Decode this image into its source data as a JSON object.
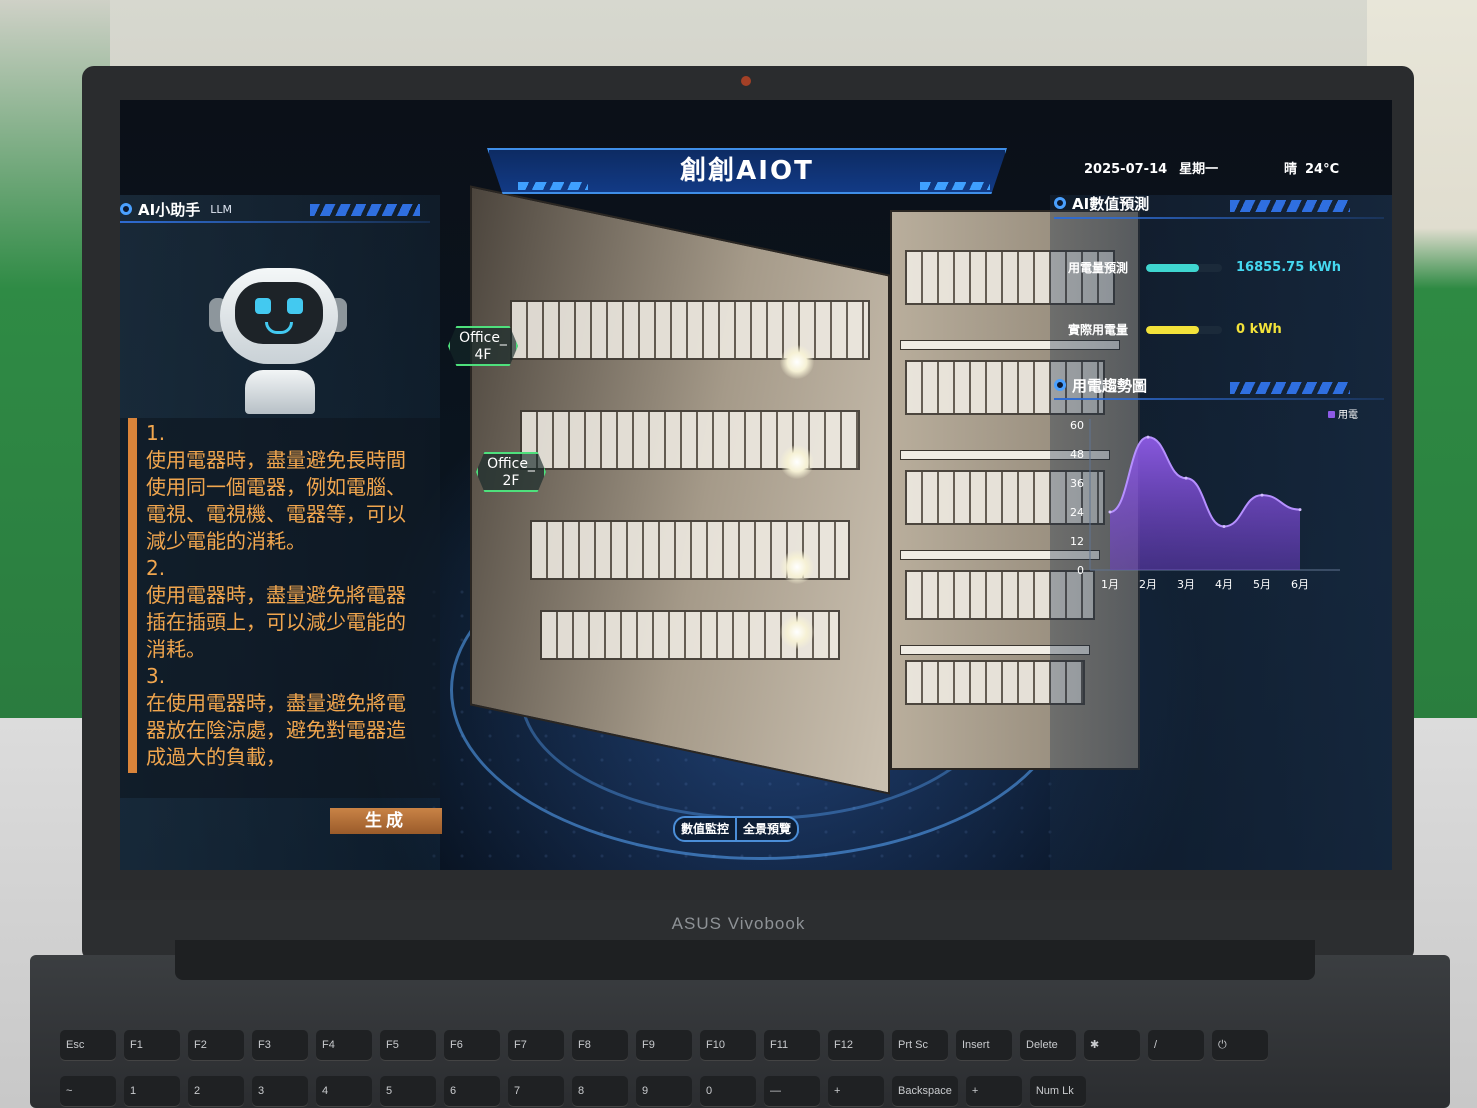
{
  "device": {
    "brand": "ASUS Vivobook"
  },
  "app": {
    "title": "創創AIOT",
    "date": "2025-07-14",
    "weekday": "星期一",
    "weather": "晴",
    "temperature": "24°C"
  },
  "left": {
    "section_title": "AI小助手",
    "section_tag": "LLM",
    "chat_text": "1.\n使用電器時，盡量避免長時間使用同一個電器，例如電腦、電視、電視機、電器等，可以減少電能的消耗。\n2.\n使用電器時，盡量避免將電器插在插頭上，可以減少電能的消耗。\n3.\n在使用電器時，盡量避免將電器放在陰涼處，避免對電器造成過大的負載，",
    "generate_button": "生成"
  },
  "scene": {
    "tags": [
      {
        "line1": "Office_",
        "line2": "4F"
      },
      {
        "line1": "Office_",
        "line2": "2F"
      }
    ],
    "tabs": [
      "數值監控",
      "全景預覽"
    ]
  },
  "right": {
    "prediction_title": "AI數值預測",
    "metrics": [
      {
        "label": "用電量預測",
        "value": "16855.75 kWh",
        "color": "#3fd6d0",
        "level": 0.7
      },
      {
        "label": "實際用電量",
        "value": "0 kWh",
        "color": "#f2e23a",
        "level": 0.7
      }
    ],
    "trend_title": "用電趨勢圖"
  },
  "chart_data": {
    "type": "area",
    "categories": [
      "1月",
      "2月",
      "3月",
      "4月",
      "5月",
      "6月"
    ],
    "series": [
      {
        "name": "用電",
        "values": [
          24,
          55,
          38,
          18,
          31,
          25
        ],
        "color": "#8e5be6"
      }
    ],
    "yticks": [
      0,
      12,
      24,
      36,
      48,
      60
    ],
    "ylim": [
      0,
      60
    ],
    "legend": "top-right"
  },
  "keyboard": {
    "row1": [
      "Esc",
      "F1",
      "F2",
      "F3",
      "F4",
      "F5",
      "F6",
      "F7",
      "F8",
      "F9",
      "F10",
      "F11",
      "F12",
      "Prt Sc",
      "Insert",
      "Delete",
      "✱",
      "/",
      "⏻"
    ],
    "row2": [
      "~",
      "1",
      "2",
      "3",
      "4",
      "5",
      "6",
      "7",
      "8",
      "9",
      "0",
      "—",
      "+",
      "Backspace",
      "+",
      "Num Lk"
    ]
  }
}
